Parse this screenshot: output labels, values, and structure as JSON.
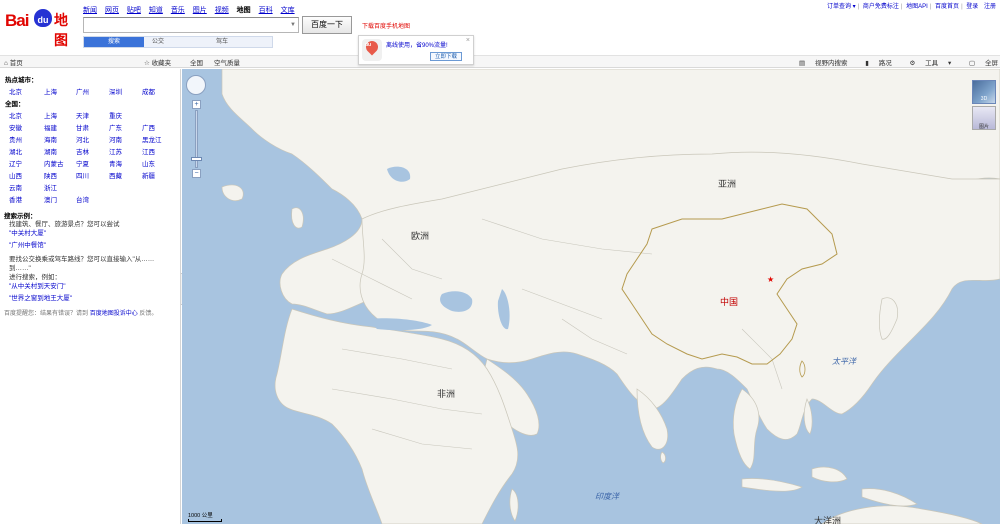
{
  "header": {
    "logo_text_bai": "Bai",
    "logo_text_du": "du",
    "logo_text_ditu": "地图",
    "nav": [
      "新闻",
      "网页",
      "贴吧",
      "知道",
      "音乐",
      "图片",
      "视频",
      "地图",
      "百科",
      "文库"
    ],
    "nav_current": "地图",
    "search_value": "",
    "search_button": "百度一下",
    "download_phone": "下载百度手机地图",
    "mode_tabs": [
      "搜索",
      "公交",
      "驾车"
    ],
    "mode_selected": "搜索",
    "top_links": [
      "订单查询",
      "商户免费标注",
      "地图API",
      "百度首页",
      "登录",
      "注册"
    ]
  },
  "promo": {
    "message": "离线使用，省90%流量!",
    "button": "立即下载",
    "close": "×",
    "icon_text": "du"
  },
  "toolbar": {
    "home": "首页",
    "favorites": "收藏夹",
    "country": "全国",
    "air_quality": "空气质量",
    "right_items": [
      "视野内搜索",
      "路况",
      "工具",
      "全屏"
    ]
  },
  "sidebar": {
    "hot_cities_title": "热点城市：",
    "hot_cities": [
      "北京",
      "上海",
      "广州",
      "深圳",
      "成都"
    ],
    "nation_title": "全国：",
    "provinces": [
      [
        "北京",
        "上海",
        "天津",
        "重庆",
        ""
      ],
      [
        "安徽",
        "福建",
        "甘肃",
        "广东",
        "广西"
      ],
      [
        "贵州",
        "海南",
        "河北",
        "河南",
        "黑龙江"
      ],
      [
        "湖北",
        "湖南",
        "吉林",
        "江苏",
        "江西"
      ],
      [
        "辽宁",
        "内蒙古",
        "宁夏",
        "青海",
        "山东"
      ],
      [
        "山西",
        "陕西",
        "四川",
        "西藏",
        "新疆"
      ],
      [
        "云南",
        "浙江",
        "",
        "",
        ""
      ],
      [
        "香港",
        "澳门",
        "台湾",
        "",
        ""
      ]
    ],
    "examples_title": "搜索示例：",
    "example_1_text": "找建筑、餐厅、旅游景点？您可以尝试",
    "example_1_link": "\"中关村大厦\"",
    "example_2_link": "\"广州中餐馆\"",
    "example_3_text_a": "要找公交换乘或驾车路线？您可以直接输入\"从……到……\"",
    "example_3_text_b": "进行搜索，例如：",
    "example_3_link": "\"从中关村到天安门\"",
    "example_4_link": "\"世界之窗到地王大厦\"",
    "feedback_prefix": "百度提醒您：结果有错误？请到",
    "feedback_link": "百度地图投诉中心",
    "feedback_suffix": "反馈。",
    "collapse_glyph": "‹"
  },
  "map": {
    "labels": {
      "asia": "亚洲",
      "europe": "欧洲",
      "africa": "非洲",
      "china": "中国",
      "pacific": "太平洋",
      "indian_ocean": "印度洋",
      "oceania": "大洋洲"
    },
    "scale": "1000 公里",
    "map_type_1": "3D",
    "map_type_2": "图片",
    "zoom_in": "+",
    "zoom_out": "−"
  }
}
